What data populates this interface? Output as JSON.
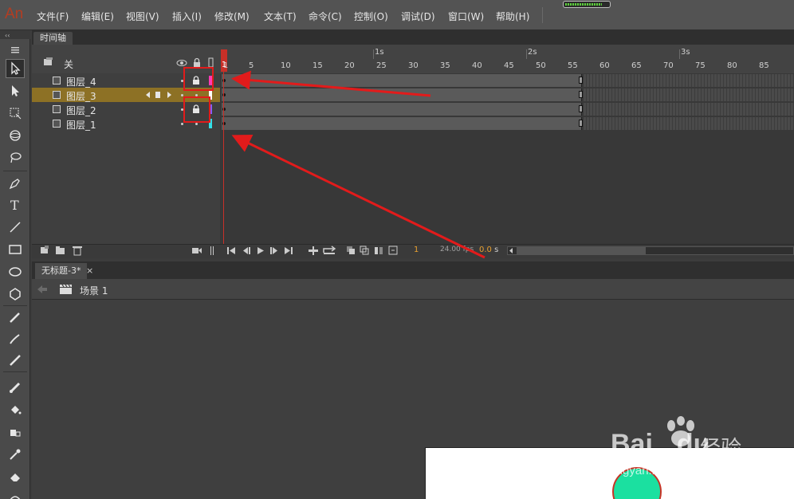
{
  "app": {
    "logo": "An"
  },
  "menu": [
    "文件(F)",
    "编辑(E)",
    "视图(V)",
    "插入(I)",
    "修改(M)",
    "文本(T)",
    "命令(C)",
    "控制(O)",
    "调试(D)",
    "窗口(W)",
    "帮助(H)"
  ],
  "status_meter": {
    "level": 0.85
  },
  "timeline": {
    "tab_label": "时间轴",
    "header_label": "关",
    "ruler": {
      "frames": [
        "1",
        "5",
        "10",
        "15",
        "20",
        "25",
        "30",
        "35",
        "40",
        "45",
        "50",
        "55",
        "60",
        "65",
        "70",
        "75",
        "80",
        "85"
      ],
      "seconds": [
        "1s",
        "2s",
        "3s"
      ]
    },
    "playhead_frame": "1",
    "layers": [
      {
        "name": "图层_4",
        "locked": true,
        "color": "#ff3bb4",
        "active": false
      },
      {
        "name": "图层_3",
        "locked": false,
        "color": "#ffffff",
        "active": true
      },
      {
        "name": "图层_2",
        "locked": true,
        "color": "#8a5cff",
        "active": false
      },
      {
        "name": "图层_1",
        "locked": false,
        "color": "#33e0e8",
        "active": false
      }
    ],
    "controls": {
      "current_frame": "1",
      "fps": "24.00 fps",
      "time": "0.0",
      "time_unit": "s"
    }
  },
  "document": {
    "tab_label": "无标题-3*",
    "close_glyph": "×",
    "scene_label": "场景 1"
  },
  "stage": {
    "circle_fill": "#1be0a0",
    "circle_stroke": "#c63426"
  },
  "watermark": {
    "logo": "Bai",
    "logo_tail": "du",
    "cn": "经验",
    "url": "jingyan.baidu.com"
  }
}
